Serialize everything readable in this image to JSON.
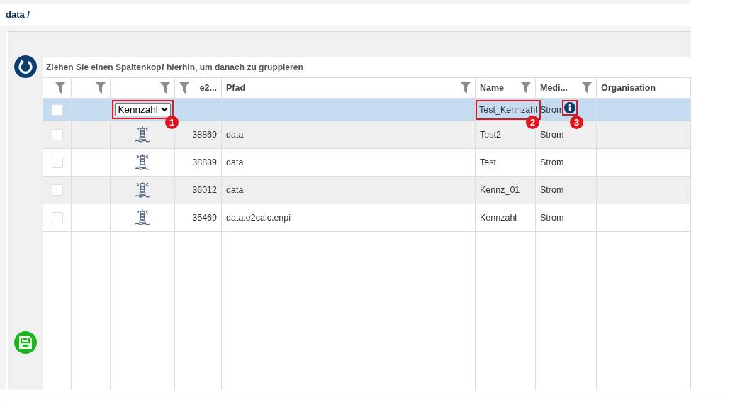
{
  "breadcrumb": "data /",
  "group_panel": {
    "hint": "Ziehen Sie einen Spaltenkopf hierhin, um danach zu gruppieren"
  },
  "columns": [
    {
      "kind": "text",
      "filter": true
    },
    {
      "kind": "text",
      "filter": true
    },
    {
      "kind": "text",
      "filter": true
    },
    {
      "label": "e2...",
      "kind": "number",
      "filter": true
    },
    {
      "label": "Pfad",
      "kind": "text",
      "filter": true
    },
    {
      "label": "Name",
      "kind": "text",
      "filter": true
    },
    {
      "label": "Medi...",
      "kind": "text",
      "filter": true
    },
    {
      "label": "Organisation",
      "kind": "text",
      "filter": false
    }
  ],
  "rows": [
    {
      "kind": "edit",
      "selected": true,
      "checked": false,
      "type": "Kennzahl",
      "name": "Test_Kennzahl",
      "medium": "Strom",
      "info": true,
      "type_callout": "1",
      "name_callout": "2",
      "info_callout": "3"
    },
    {
      "kind": "item",
      "selected": false,
      "checked": false,
      "id": "38869",
      "path": "data",
      "name": "Test2",
      "medium": "Strom",
      "info": false
    },
    {
      "kind": "item",
      "selected": false,
      "checked": false,
      "id": "38839",
      "path": "data",
      "name": "Test",
      "medium": "Strom",
      "info": false
    },
    {
      "kind": "item",
      "selected": false,
      "checked": false,
      "id": "36012",
      "path": "data",
      "name": "Kennz_01",
      "medium": "Strom",
      "info": false
    },
    {
      "kind": "item",
      "selected": false,
      "checked": false,
      "id": "35469",
      "path": "data.e2calc.enpi",
      "name": "Kennzahl",
      "medium": "Strom",
      "info": false
    }
  ]
}
